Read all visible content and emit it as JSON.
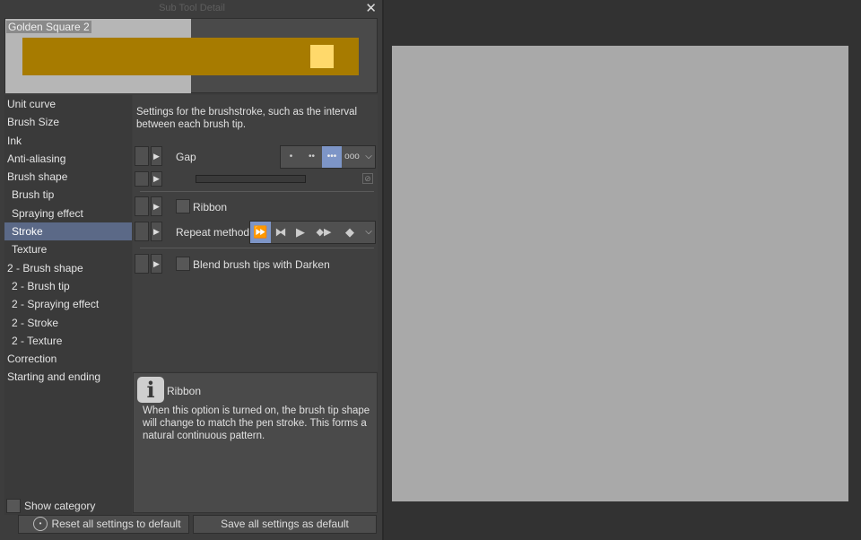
{
  "window": {
    "title": "Sub Tool Detail",
    "close_icon": "close-icon"
  },
  "preview": {
    "name": "Golden Square 2",
    "colors": {
      "bar": "#a77b00",
      "tip": "#ffd96b"
    }
  },
  "categories": [
    {
      "label": "Unit curve",
      "sub": false
    },
    {
      "label": "Brush Size",
      "sub": false
    },
    {
      "label": "Ink",
      "sub": false
    },
    {
      "label": "Anti-aliasing",
      "sub": false
    },
    {
      "label": "Brush shape",
      "sub": false
    },
    {
      "label": "Brush tip",
      "sub": true
    },
    {
      "label": "Spraying effect",
      "sub": true
    },
    {
      "label": "Stroke",
      "sub": true,
      "selected": true
    },
    {
      "label": "Texture",
      "sub": true
    },
    {
      "label": "2 - Brush shape",
      "sub": false
    },
    {
      "label": "2 - Brush tip",
      "sub": true
    },
    {
      "label": "2 - Spraying effect",
      "sub": true
    },
    {
      "label": "2 - Stroke",
      "sub": true
    },
    {
      "label": "2 - Texture",
      "sub": true
    },
    {
      "label": "Correction",
      "sub": false
    },
    {
      "label": "Starting and ending",
      "sub": false
    }
  ],
  "show_category": {
    "label": "Show category",
    "checked": false
  },
  "panel": {
    "description": "Settings for the brushstroke, such as the interval between each brush tip.",
    "gap": {
      "label": "Gap",
      "options": [
        "•",
        "••",
        "•••",
        "ooo"
      ],
      "selected": 2
    },
    "ribbon": {
      "label": "Ribbon",
      "checked": false
    },
    "repeat": {
      "label": "Repeat method",
      "options": [
        "⏩",
        "⧓",
        "▶",
        "◆▶",
        "◆"
      ],
      "selected": 0
    },
    "blend": {
      "label": "Blend brush tips with Darken",
      "checked": false
    }
  },
  "info": {
    "title": "Ribbon",
    "text": "When this option is turned on, the brush tip shape will change to match the pen stroke. This forms a natural continuous pattern."
  },
  "buttons": {
    "reset": "Reset all settings to default",
    "save": "Save all settings as default"
  },
  "accent": "#7d95c7"
}
